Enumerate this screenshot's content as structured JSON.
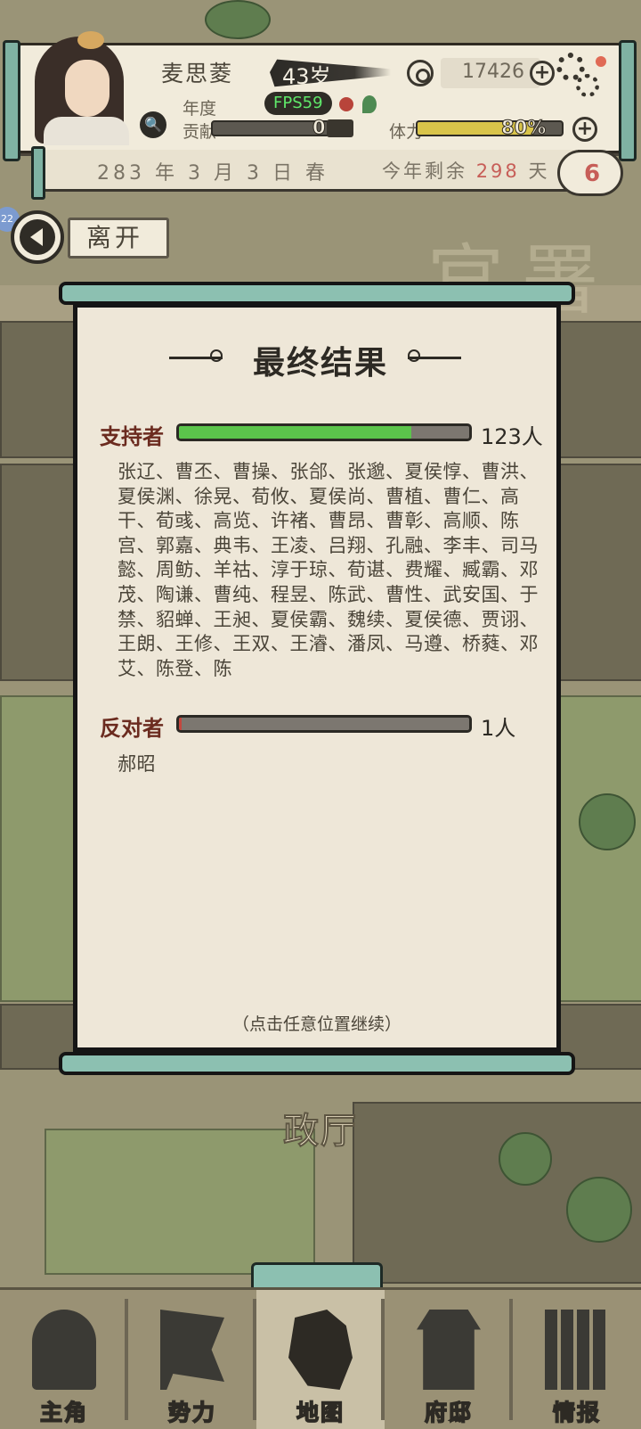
{
  "header": {
    "name": "麦思菱",
    "age": "43岁",
    "money": "17426",
    "year_label": "年度",
    "contribution_label": "贡献",
    "contribution_value": "0",
    "contribution_fraction": 0.0,
    "stamina_label": "体力",
    "stamina_value": "80%",
    "stamina_fraction": 0.8,
    "fps": "FPS59",
    "icons": [
      "search-icon",
      "copper-coin-icon",
      "plus-icon",
      "settings-gear-icon"
    ]
  },
  "datebar": {
    "date": "283 年 3 月 3 日 春",
    "remaining_prefix": "今年剩余",
    "remaining_days": "298",
    "remaining_suffix": "天",
    "badge": "6"
  },
  "side_badge": "22",
  "leave_button": {
    "label": "离开"
  },
  "map": {
    "hall_label": "政厅",
    "bg_text": "官署"
  },
  "dialog": {
    "title": "最终结果",
    "supporters": {
      "label": "支持者",
      "count": "123人",
      "fraction": 0.8,
      "names": "张辽、曹丕、曹操、张郃、张邈、夏侯惇、曹洪、夏侯渊、徐晃、荀攸、夏侯尚、曹植、曹仁、高干、荀彧、高览、许褚、曹昂、曹彰、高顺、陈宫、郭嘉、典韦、王凌、吕翔、孔融、李丰、司马懿、周鲂、羊祜、淳于琼、荀谌、费耀、臧霸、邓茂、陶谦、曹纯、程昱、陈武、曹性、武安国、于禁、貂蝉、王昶、夏侯霸、魏续、夏侯德、贾诩、王朗、王修、王双、王濬、潘凤、马遵、桥蕤、邓艾、陈登、陈"
    },
    "opponents": {
      "label": "反对者",
      "count": "1人",
      "fraction": 0.008,
      "names": "郝昭"
    },
    "hint": "（点击任意位置继续）"
  },
  "nav": {
    "items": [
      {
        "label": "主角",
        "icon": "hero-icon"
      },
      {
        "label": "势力",
        "icon": "flag-icon"
      },
      {
        "label": "地图",
        "icon": "map-icon"
      },
      {
        "label": "府邸",
        "icon": "mansion-icon"
      },
      {
        "label": "情报",
        "icon": "scroll-icon"
      }
    ],
    "active": "地图"
  }
}
